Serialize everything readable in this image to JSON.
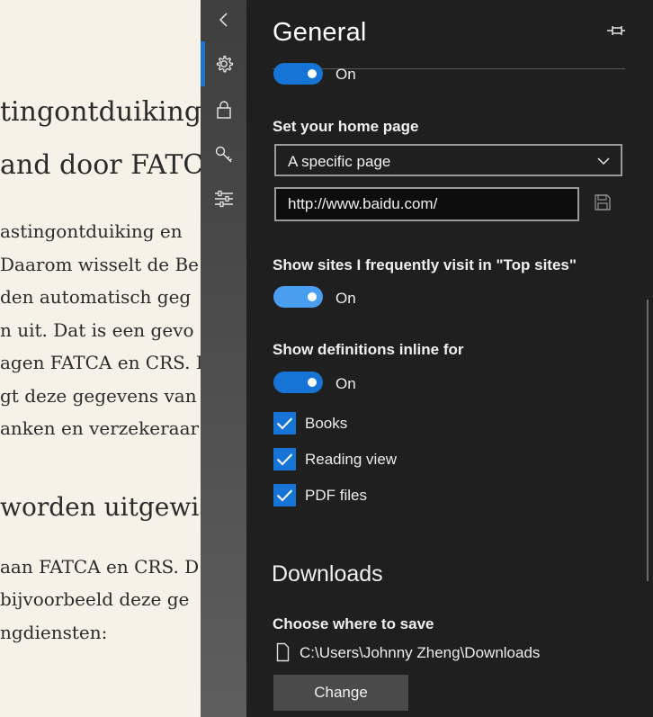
{
  "reader": {
    "heading_lines": [
      "tingontduiking",
      "and door FATC"
    ],
    "para1_lines": [
      "astingontduiking en",
      "Daarom wisselt de Be",
      "den automatisch geg",
      "n uit. Dat is een gevo",
      "agen FATCA en CRS. I",
      "gt deze gegevens van",
      "anken en verzekeraar"
    ],
    "heading2": "worden uitgewiss",
    "para2_lines": [
      "aan FATCA en CRS. D",
      " bijvoorbeeld deze ge",
      "ngdiensten:"
    ]
  },
  "rail": {
    "icons": [
      "back-icon",
      "gear-icon",
      "lock-icon",
      "key-icon",
      "sliders-icon"
    ],
    "active": "gear-icon"
  },
  "panel": {
    "title": "General",
    "top_toggle": {
      "state": "On",
      "on": true
    },
    "home_page": {
      "label": "Set your home page",
      "selected": "A specific page",
      "url": "http://www.baidu.com/"
    },
    "top_sites": {
      "label": "Show sites I frequently visit in \"Top sites\"",
      "state": "On",
      "on": true
    },
    "definitions": {
      "label": "Show definitions inline for",
      "state": "On",
      "on": true,
      "options": [
        {
          "label": "Books",
          "checked": true
        },
        {
          "label": "Reading view",
          "checked": true
        },
        {
          "label": "PDF files",
          "checked": true
        }
      ]
    },
    "downloads": {
      "section_title": "Downloads",
      "choose_label": "Choose where to save",
      "path": "C:\\Users\\Johnny Zheng\\Downloads",
      "change_button": "Change"
    }
  },
  "colors": {
    "accent": "#1674d6",
    "toggle_light": "#4a9ef0",
    "panel_bg": "#1f1f1f",
    "reader_bg": "#f7f2e7"
  }
}
